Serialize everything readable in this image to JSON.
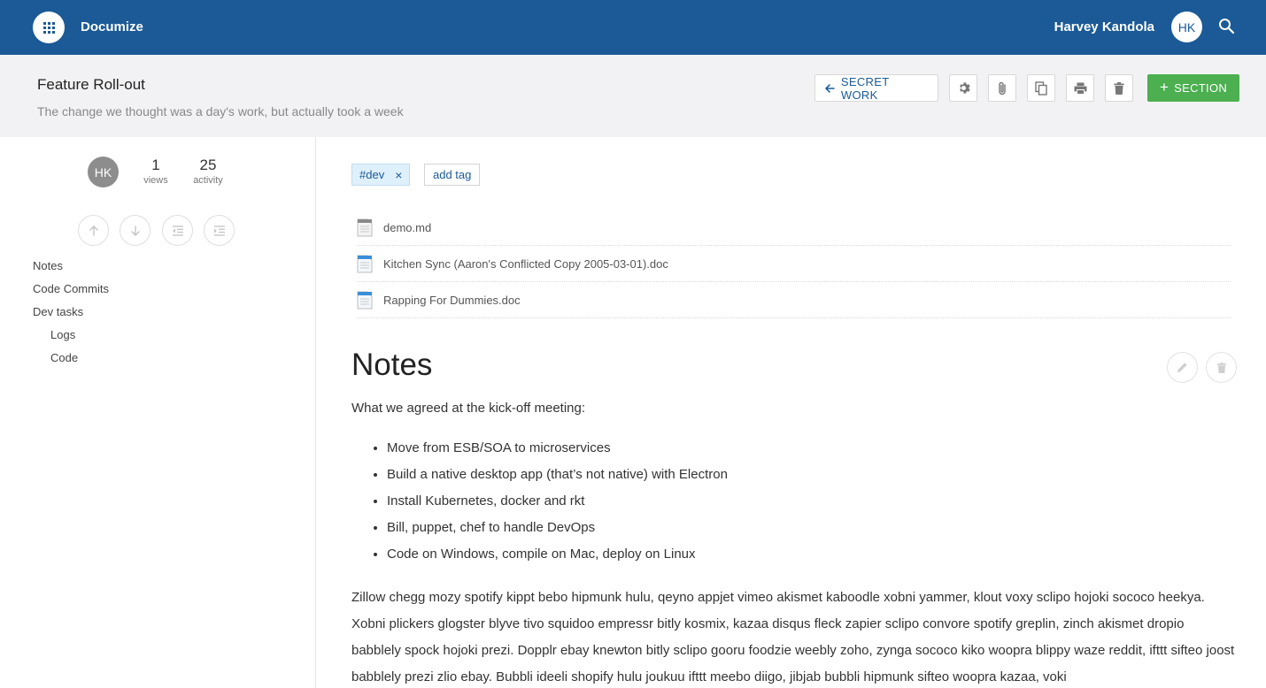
{
  "app": {
    "name": "Documize"
  },
  "user": {
    "name": "Harvey Kandola",
    "initials": "HK"
  },
  "document": {
    "title": "Feature Roll-out",
    "excerpt": "The change we thought was a day's work, but actually took a week"
  },
  "toolbar": {
    "space_label": "SECRET WORK",
    "section_label": "SECTION"
  },
  "sidebar": {
    "initials": "HK",
    "views": {
      "num": "1",
      "label": "views"
    },
    "activity": {
      "num": "25",
      "label": "activity"
    },
    "toc": [
      {
        "label": "Notes"
      },
      {
        "label": "Code Commits"
      },
      {
        "label": "Dev tasks"
      },
      {
        "label": "Logs"
      },
      {
        "label": "Code"
      }
    ]
  },
  "tags": {
    "items": [
      "#dev"
    ],
    "add_label": "add tag",
    "remove_glyph": "×"
  },
  "attachments": [
    {
      "name": "demo.md"
    },
    {
      "name": "Kitchen Sync (Aaron's Conflicted Copy 2005-03-01).doc"
    },
    {
      "name": "Rapping For Dummies.doc"
    }
  ],
  "section": {
    "title": "Notes",
    "intro": "What we agreed at the kick-off meeting:",
    "bullets": [
      "Move from ESB/SOA to microservices",
      "Build a native desktop app (that’s not native) with Electron",
      "Install Kubernetes, docker and rkt",
      "Bill, puppet, chef to handle DevOps",
      "Code on Windows, compile on Mac, deploy on Linux"
    ],
    "paragraph": "Zillow chegg mozy spotify kippt bebo hipmunk hulu, qeyno appjet vimeo akismet kaboodle xobni yammer, klout voxy sclipo hojoki sococo heekya. Xobni plickers glogster blyve tivo squidoo empressr bitly kosmix, kazaa disqus fleck zapier sclipo convore spotify greplin, zinch akismet dropio babblely spock hojoki prezi. Dopplr ebay knewton bitly sclipo gooru foodzie weebly zoho, zynga sococo kiko woopra blippy waze reddit, ifttt sifteo joost babblely prezi zlio ebay. Bubbli ideeli shopify hulu joukuu ifttt meebo diigo, jibjab bubbli hipmunk sifteo woopra kazaa, voki"
  },
  "colors": {
    "topbar": "#1b5a96",
    "accent": "#1b5a96",
    "section_button": "#4caf50",
    "header_bg": "#f2f2f4"
  },
  "icons": [
    "apps-grid-icon",
    "search-icon",
    "arrow-left-icon",
    "gear-icon",
    "paperclip-icon",
    "copy-icon",
    "print-icon",
    "trash-icon",
    "plus-icon",
    "arrow-up-icon",
    "arrow-down-icon",
    "outdent-icon",
    "indent-icon",
    "file-icon",
    "pencil-icon"
  ]
}
